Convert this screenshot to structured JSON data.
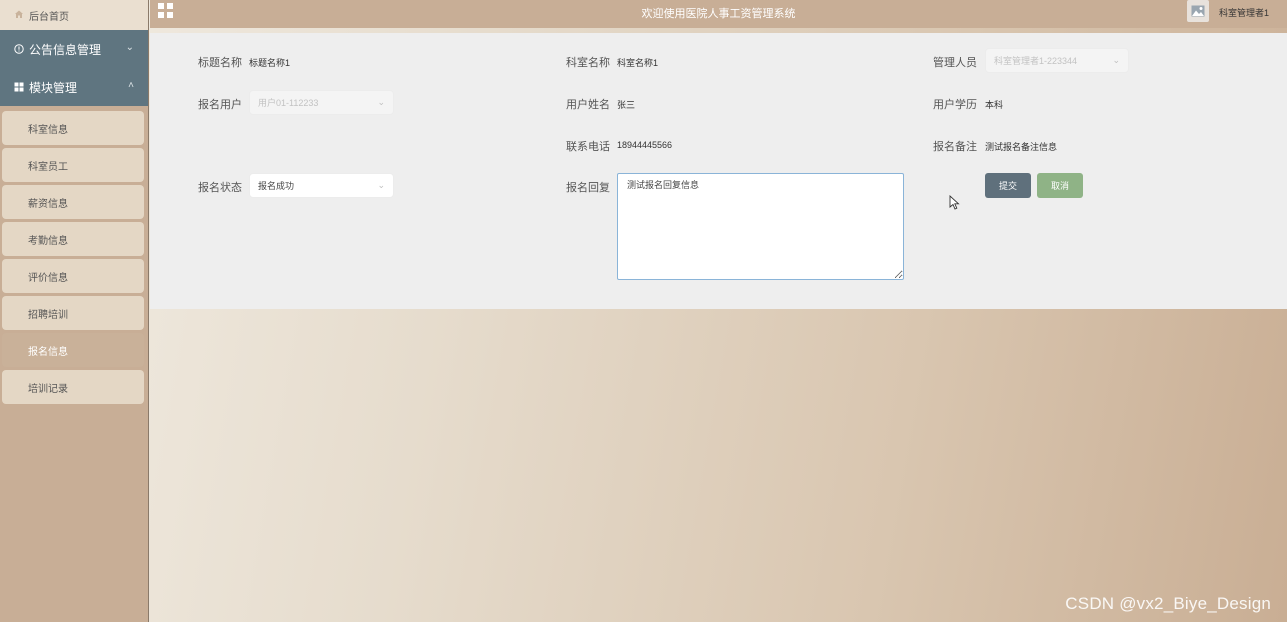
{
  "sidebar": {
    "home_label": "后台首页",
    "groups": [
      {
        "label": "公告信息管理",
        "chevron": "chevron-down"
      },
      {
        "label": "模块管理",
        "chevron": "chevron-up"
      }
    ],
    "items": [
      "科室信息",
      "科室员工",
      "薪资信息",
      "考勤信息",
      "评价信息",
      "招聘培训",
      "报名信息",
      "培训记录"
    ],
    "active_item": "报名信息"
  },
  "header": {
    "title": "欢迎使用医院人事工资管理系统",
    "user_name": "科室管理者1"
  },
  "form": {
    "title_label": "标题名称",
    "title_value": "标题名称1",
    "dept_label": "科室名称",
    "dept_value": "科室名称1",
    "manager_label": "管理人员",
    "manager_value": "科室管理者1-223344",
    "signup_user_label": "报名用户",
    "signup_user_value": "用户01-112233",
    "user_name_label": "用户姓名",
    "user_name_value": "张三",
    "education_label": "用户学历",
    "education_value": "本科",
    "phone_label": "联系电话",
    "phone_value": "18944445566",
    "remark_label": "报名备注",
    "remark_value": "测试报名备注信息",
    "status_label": "报名状态",
    "status_value": "报名成功",
    "reply_label": "报名回复",
    "reply_value": "测试报名回复信息",
    "submit_label": "提交",
    "cancel_label": "取消"
  },
  "watermark": "CSDN @vx2_Biye_Design"
}
